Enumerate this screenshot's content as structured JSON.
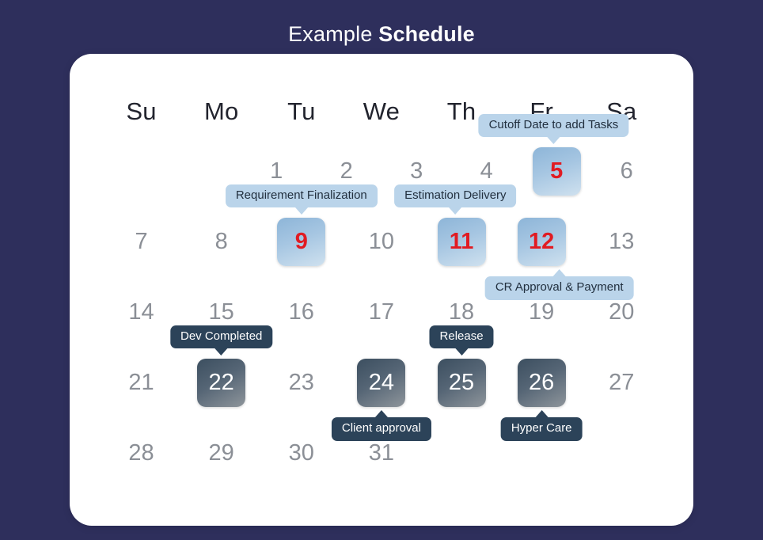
{
  "title": {
    "light_part": "Example ",
    "bold_part": "Schedule"
  },
  "colors": {
    "background": "#2e2f5c",
    "card": "#ffffff",
    "day_text": "#8b8f96",
    "dayname_text": "#22242e",
    "highlight_red": "#e11b22",
    "tooltip_light_bg": "#bad4ea",
    "tooltip_light_text": "#22303f",
    "tooltip_dark_bg": "#2c4359",
    "tooltip_dark_text": "#ffffff",
    "daybox_blue_gradient": "#8db5d8 -> #cfe1ef",
    "daybox_dark_gradient": "#3c4f60 -> #8e959b"
  },
  "weekdays": [
    "Su",
    "Mo",
    "Tu",
    "We",
    "Th",
    "Fr",
    "Sa"
  ],
  "weeks": [
    [
      {
        "label": "",
        "style": "empty"
      },
      {
        "label": "",
        "style": "empty"
      },
      {
        "label": "1",
        "style": "plain"
      },
      {
        "label": "2",
        "style": "plain"
      },
      {
        "label": "3",
        "style": "plain"
      },
      {
        "label": "4",
        "style": "plain"
      },
      {
        "label": "5",
        "style": "blue"
      },
      {
        "label": "6",
        "style": "plain"
      }
    ],
    [
      {
        "label": "7",
        "style": "plain"
      },
      {
        "label": "8",
        "style": "plain"
      },
      {
        "label": "9",
        "style": "blue"
      },
      {
        "label": "10",
        "style": "plain"
      },
      {
        "label": "11",
        "style": "blue"
      },
      {
        "label": "12",
        "style": "blue"
      },
      {
        "label": "13",
        "style": "plain"
      }
    ],
    [
      {
        "label": "14",
        "style": "plain"
      },
      {
        "label": "15",
        "style": "plain"
      },
      {
        "label": "16",
        "style": "plain"
      },
      {
        "label": "17",
        "style": "plain"
      },
      {
        "label": "18",
        "style": "plain"
      },
      {
        "label": "19",
        "style": "plain"
      },
      {
        "label": "20",
        "style": "plain"
      }
    ],
    [
      {
        "label": "21",
        "style": "plain"
      },
      {
        "label": "22",
        "style": "dark"
      },
      {
        "label": "23",
        "style": "plain"
      },
      {
        "label": "24",
        "style": "dark"
      },
      {
        "label": "25",
        "style": "dark"
      },
      {
        "label": "26",
        "style": "dark"
      },
      {
        "label": "27",
        "style": "plain"
      }
    ],
    [
      {
        "label": "28",
        "style": "plain"
      },
      {
        "label": "29",
        "style": "plain"
      },
      {
        "label": "30",
        "style": "plain"
      },
      {
        "label": "31",
        "style": "plain"
      },
      {
        "label": "",
        "style": "empty"
      },
      {
        "label": "",
        "style": "empty"
      },
      {
        "label": "",
        "style": "empty"
      }
    ]
  ],
  "week1": {
    "d0": "",
    "d1": "",
    "d2": "1",
    "d3": "2",
    "d4": "3",
    "d5": "4",
    "d6": "5",
    "d7": "6"
  },
  "week2": {
    "d0": "7",
    "d1": "8",
    "d2": "9",
    "d3": "10",
    "d4": "11",
    "d5": "12",
    "d6": "13"
  },
  "week3": {
    "d0": "14",
    "d1": "15",
    "d2": "16",
    "d3": "17",
    "d4": "18",
    "d5": "19",
    "d6": "20"
  },
  "week4": {
    "d0": "21",
    "d1": "22",
    "d2": "23",
    "d3": "24",
    "d4": "25",
    "d5": "26",
    "d6": "27"
  },
  "week5": {
    "d0": "28",
    "d1": "29",
    "d2": "30",
    "d3": "31"
  },
  "events": {
    "cutoff": "Cutoff Date to add Tasks",
    "requirement": "Requirement Finalization",
    "estimation": "Estimation Delivery",
    "cr_approval": "CR Approval & Payment",
    "dev_completed": "Dev Completed",
    "release": "Release",
    "client_approval": "Client approval",
    "hyper_care": "Hyper Care"
  }
}
